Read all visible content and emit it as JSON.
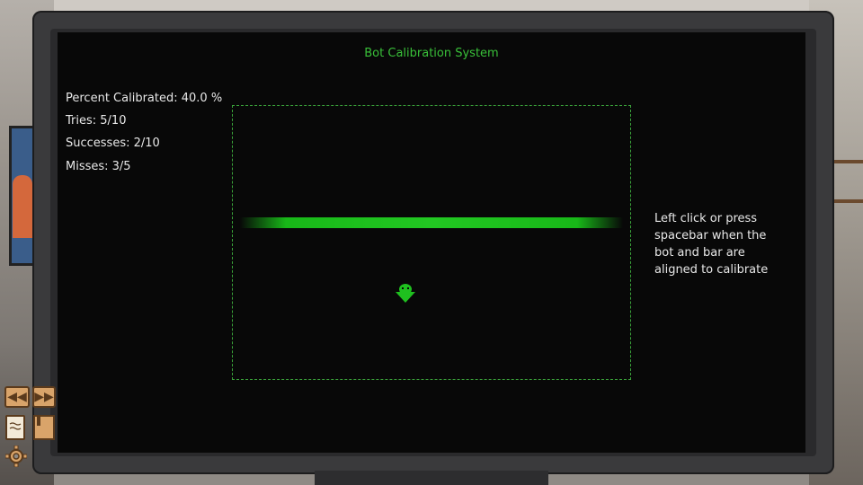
{
  "window": {
    "title": "Bot Calibration System"
  },
  "stats": {
    "percent_calibrated": "Percent Calibrated: 40.0 %",
    "tries": "Tries: 5/10",
    "successes": "Successes: 2/10",
    "misses": "Misses: 3/5"
  },
  "instructions": {
    "text": "Left click or press spacebar when the bot and bar are aligned to calibrate"
  },
  "controls": {
    "rewind_glyph": "◀◀",
    "fast_forward_glyph": "▶▶"
  },
  "colors": {
    "accent_green": "#39c039",
    "bar_green": "#22c822",
    "screen_bg": "#080808",
    "text": "#e8e8e8"
  },
  "icons": {
    "bot": "bot-icon",
    "rewind": "rewind-icon",
    "fast_forward": "fast-forward-icon",
    "journal": "journal-icon",
    "bookmark": "bookmark-icon",
    "settings": "gear-icon"
  }
}
